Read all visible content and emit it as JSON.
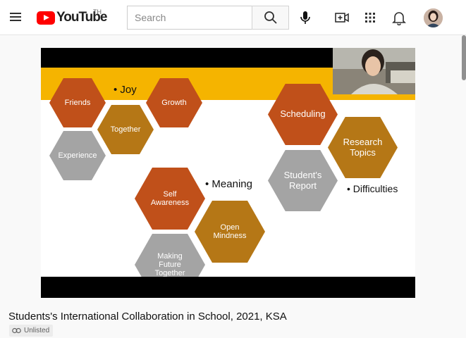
{
  "header": {
    "logo_text": "YouTube",
    "country_code": "TH",
    "search_placeholder": "Search",
    "icons": [
      "menu-icon",
      "search-icon",
      "microphone-icon",
      "create-video-icon",
      "apps-grid-icon",
      "notifications-bell-icon",
      "avatar"
    ]
  },
  "slide": {
    "hexagons": [
      {
        "label": "Friends",
        "color": "#c0501a"
      },
      {
        "label": "Together",
        "color": "#b57716"
      },
      {
        "label": "Growth",
        "color": "#c0501a"
      },
      {
        "label": "Experience",
        "color": "#a4a4a4"
      },
      {
        "label": "Scheduling",
        "color": "#c0501a"
      },
      {
        "label": "Research Topics",
        "color": "#b57716"
      },
      {
        "label": "Student's Report",
        "color": "#a4a4a4"
      },
      {
        "label": "Self Awareness",
        "color": "#c0501a"
      },
      {
        "label": "Open Mindness",
        "color": "#b57716"
      },
      {
        "label": "Making Future Together",
        "color": "#a4a4a4"
      }
    ],
    "bullets": [
      "• Joy",
      "• Meaning",
      "• Difficulties"
    ]
  },
  "video": {
    "title": "Students's International Collaboration in School, 2021, KSA",
    "visibility": "Unlisted"
  },
  "colors": {
    "brand_red": "#ff0000",
    "banner_yellow": "#f5b400",
    "hex_orange": "#c0501a",
    "hex_gold": "#b57716",
    "hex_gray": "#a4a4a4"
  }
}
